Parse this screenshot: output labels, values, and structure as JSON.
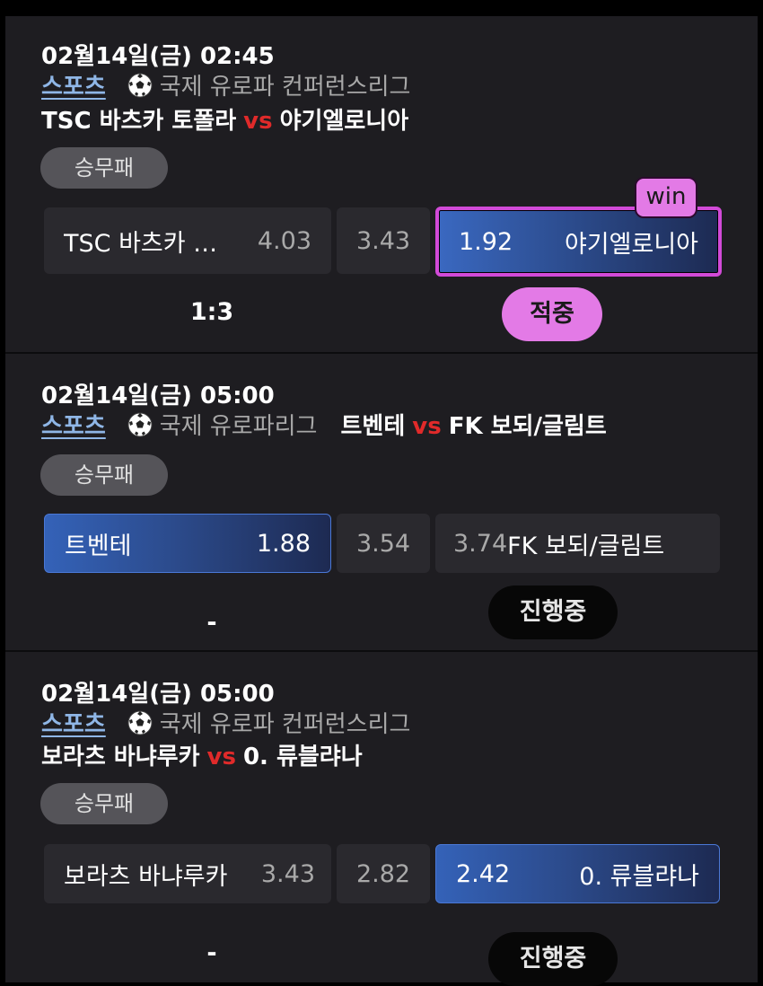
{
  "matches": [
    {
      "datetime": "02월14일(금) 02:45",
      "sport_label": "스포츠",
      "ball_icon": "soccer-ball-icon",
      "league": "국제 유로파 컨퍼런스리그",
      "home": "TSC 바츠카 토폴라",
      "vs": "vs",
      "away": "야기엘로니아",
      "bet_type": "승무패",
      "options": [
        {
          "name": "TSC 바츠카 …",
          "odd": "4.03"
        },
        {
          "odd": "3.43"
        },
        {
          "odd": "1.92",
          "name": "야기엘로니아"
        }
      ],
      "selected": "away",
      "win_tag": "win",
      "score": "1:3",
      "status": "적중"
    },
    {
      "datetime": "02월14일(금) 05:00",
      "sport_label": "스포츠",
      "ball_icon": "soccer-ball-icon",
      "league": "국제 유로파리그",
      "home": "트벤테",
      "vs": "vs",
      "away": "FK 보되/글림트",
      "bet_type": "승무패",
      "options": [
        {
          "name": "트벤테",
          "odd": "1.88"
        },
        {
          "odd": "3.54"
        },
        {
          "odd": "3.74",
          "name": "FK 보되/글림트"
        }
      ],
      "selected": "home",
      "score": "-",
      "status": "진행중"
    },
    {
      "datetime": "02월14일(금) 05:00",
      "sport_label": "스포츠",
      "ball_icon": "soccer-ball-icon",
      "league": "국제 유로파 컨퍼런스리그",
      "home": "보라츠 바냐루카",
      "vs": "vs",
      "away": "0. 류블랴나",
      "bet_type": "승무패",
      "options": [
        {
          "name": "보라츠 바냐루카",
          "odd": "3.43"
        },
        {
          "odd": "2.82"
        },
        {
          "odd": "2.42",
          "name": "0. 류블랴나"
        }
      ],
      "selected": "away",
      "score": "-",
      "status": "진행중"
    }
  ],
  "colors": {
    "background": "#1e1d21",
    "sport_link": "#8fb6e6",
    "vs": "#e02a2a",
    "win_accent": "#e37ae6",
    "selected_blue": "#3462b8"
  }
}
